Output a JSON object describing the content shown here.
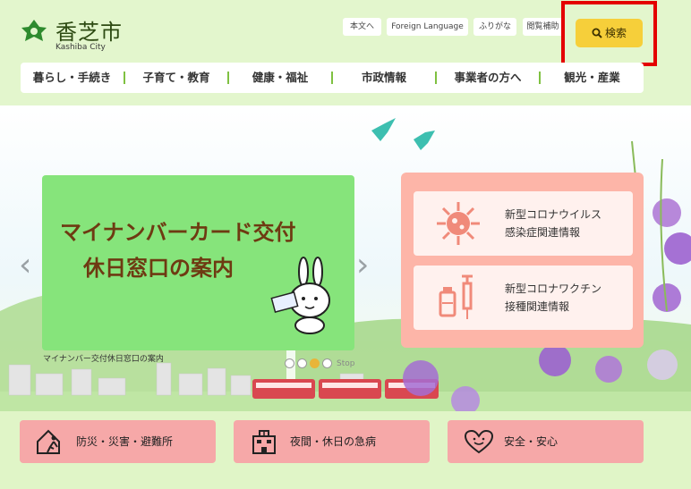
{
  "site": {
    "title": "香芝市",
    "subtitle": "Kashiba City"
  },
  "utility_links": [
    "本文へ",
    "Foreign Language",
    "ふりがな",
    "閲覧補助"
  ],
  "search": {
    "label": "検索"
  },
  "nav": [
    "暮らし・手続き",
    "子育て・教育",
    "健康・福祉",
    "市政情報",
    "事業者の方へ",
    "観光・産業"
  ],
  "banner": {
    "line1": "マイナンバーカード交付",
    "line2": "休日窓口の案内",
    "caption": "マイナンバー交付休日窓口の案内"
  },
  "carousel": {
    "active_index": 2,
    "stop_label": "Stop"
  },
  "info_cards": [
    {
      "line1": "新型コロナウイルス",
      "line2": "感染症関連情報",
      "icon": "virus-icon"
    },
    {
      "line1": "新型コロナワクチン",
      "line2": "接種関連情報",
      "icon": "vaccine-icon"
    }
  ],
  "quick_links": [
    {
      "label": "防災・災害・避難所",
      "icon": "evacuation-icon"
    },
    {
      "label": "夜間・休日の急病",
      "icon": "hospital-icon"
    },
    {
      "label": "安全・安心",
      "icon": "heart-icon"
    }
  ],
  "colors": {
    "accent": "#f6cf3a",
    "nav_separator": "#7fc141",
    "banner": "#86e47b",
    "info_panel": "#fdb5a8",
    "quick_link": "#f6a8a8"
  }
}
